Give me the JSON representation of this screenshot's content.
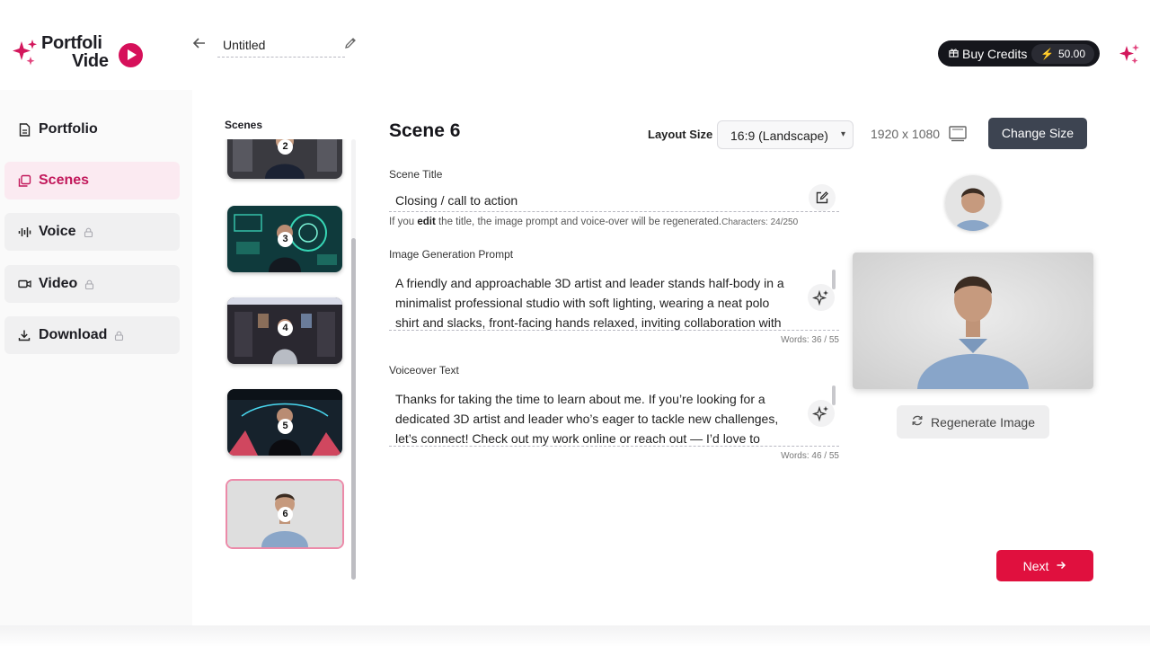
{
  "app": {
    "logo_line1": "Portfoli",
    "logo_line2": "Vide",
    "project_title": "Untitled",
    "buy_credits_label": "Buy Credits",
    "credit_balance": "50.00",
    "brand_color": "#d6105a"
  },
  "sidebar": {
    "items": [
      {
        "label": "Portfolio",
        "icon": "document-icon",
        "state": "default"
      },
      {
        "label": "Scenes",
        "icon": "layers-icon",
        "state": "active"
      },
      {
        "label": "Voice",
        "icon": "waveform-icon",
        "state": "locked"
      },
      {
        "label": "Video",
        "icon": "video-camera-icon",
        "state": "locked"
      },
      {
        "label": "Download",
        "icon": "download-icon",
        "state": "locked"
      }
    ]
  },
  "scenes": {
    "label": "Scenes",
    "thumbnails": [
      {
        "number": "2"
      },
      {
        "number": "3"
      },
      {
        "number": "4"
      },
      {
        "number": "5"
      },
      {
        "number": "6",
        "selected": true
      }
    ]
  },
  "editor": {
    "heading": "Scene 6",
    "layout_label": "Layout Size",
    "layout_value": "16:9 (Landscape)",
    "resolution": "1920 x 1080",
    "change_size_label": "Change Size",
    "scene_title_label": "Scene Title",
    "scene_title_value": "Closing / call to action",
    "hint_prefix": "If you ",
    "hint_bold": "edit",
    "hint_suffix": " the title, the image prompt and voice-over will be regenerated.",
    "title_char_count": "Characters: 24/250",
    "image_prompt_label": "Image Generation Prompt",
    "image_prompt_value": "A friendly and approachable 3D artist and leader stands half-body in a minimalist professional studio with soft lighting, wearing a neat polo shirt and slacks, front-facing hands relaxed, inviting collaboration with",
    "image_prompt_count": "Words: 36 / 55",
    "voiceover_label": "Voiceover Text",
    "voiceover_value": "Thanks for taking the time to learn about me. If you’re looking for a dedicated 3D artist and leader who’s eager to tackle new challenges, let’s connect! Check out my work online or reach out — I’d love to",
    "voiceover_count": "Words: 46 / 55"
  },
  "preview": {
    "regenerate_label": "Regenerate Image",
    "next_label": "Next"
  }
}
